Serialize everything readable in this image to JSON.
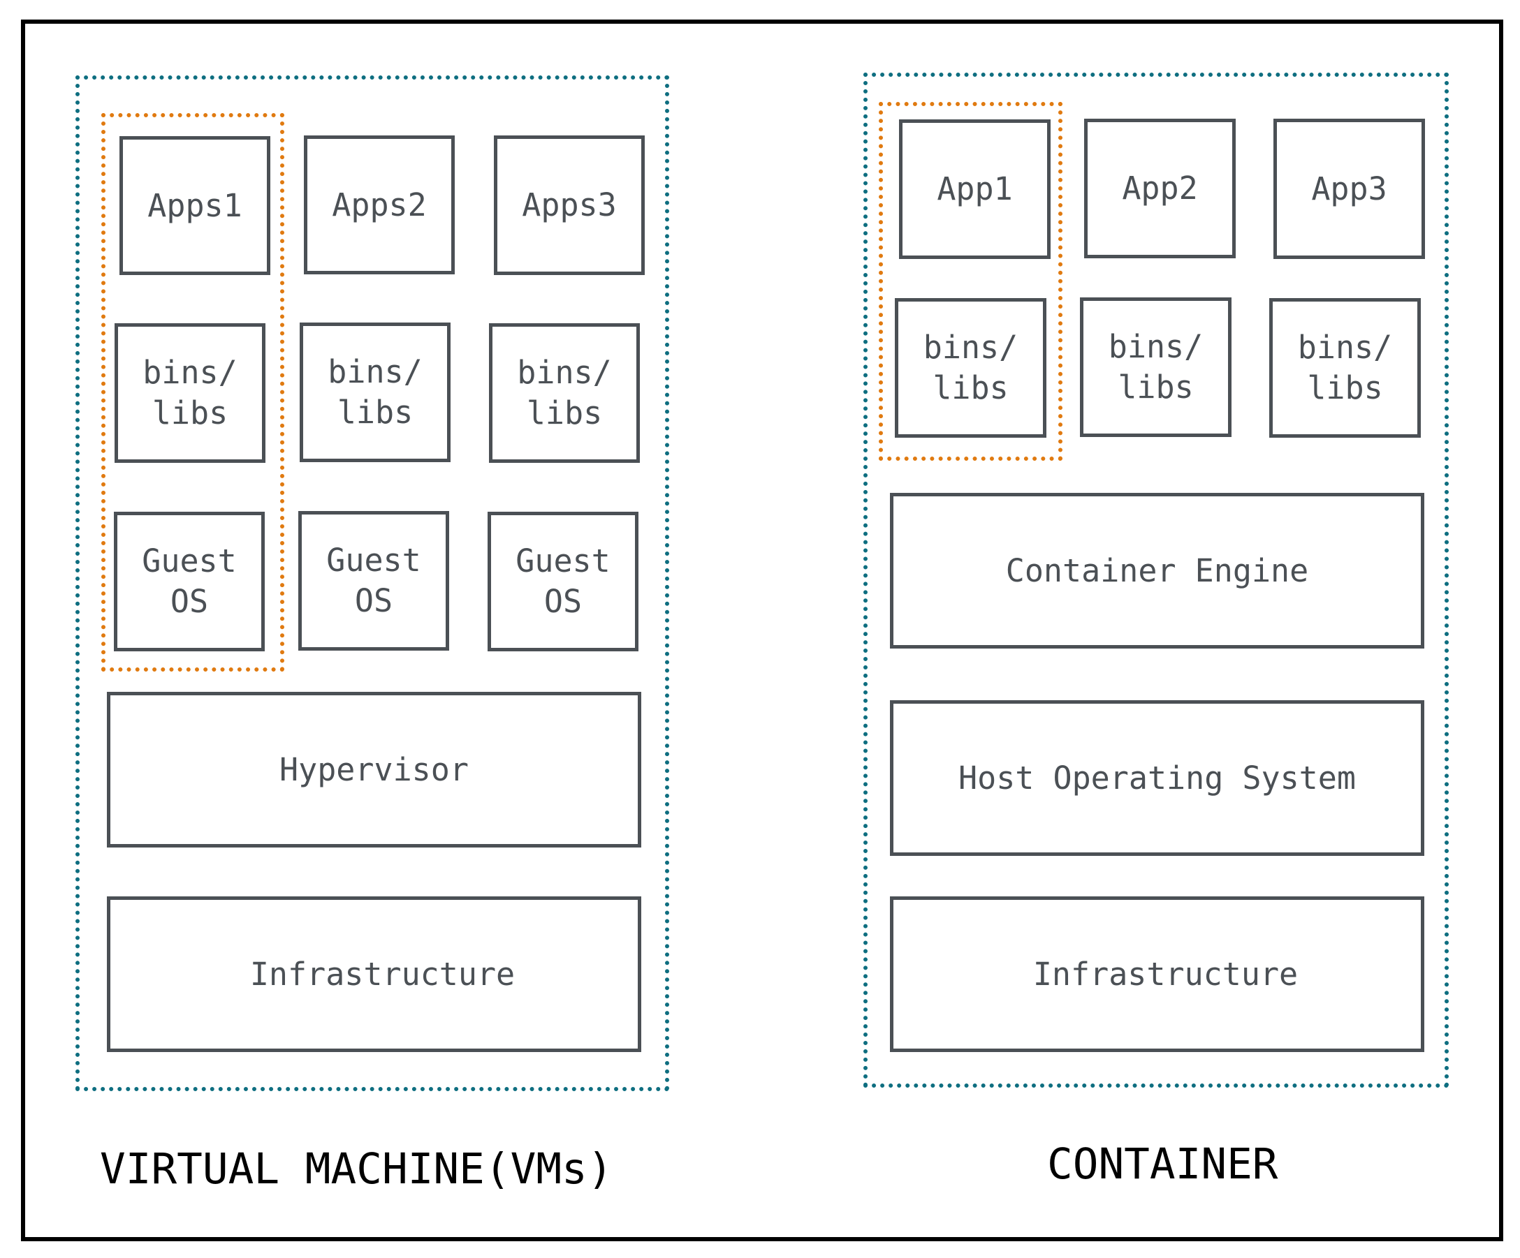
{
  "vm": {
    "label": "VIRTUAL MACHINE(VMs)",
    "apps": [
      "Apps1",
      "Apps2",
      "Apps3"
    ],
    "libs": [
      "bins/\nlibs",
      "bins/\nlibs",
      "bins/\nlibs"
    ],
    "guest_os": [
      "Guest\nOS",
      "Guest\nOS",
      "Guest\nOS"
    ],
    "hypervisor": "Hypervisor",
    "infrastructure": "Infrastructure"
  },
  "container": {
    "label": "CONTAINER",
    "apps": [
      "App1",
      "App2",
      "App3"
    ],
    "libs": [
      "bins/\nlibs",
      "bins/\nlibs",
      "bins/\nlibs"
    ],
    "engine": "Container Engine",
    "host_os": "Host Operating System",
    "infrastructure": "Infrastructure"
  },
  "colors": {
    "group_outline": "#0e6e80",
    "highlight_outline": "#e07a10",
    "box_stroke": "#4b5055",
    "label_text": "#000000"
  }
}
